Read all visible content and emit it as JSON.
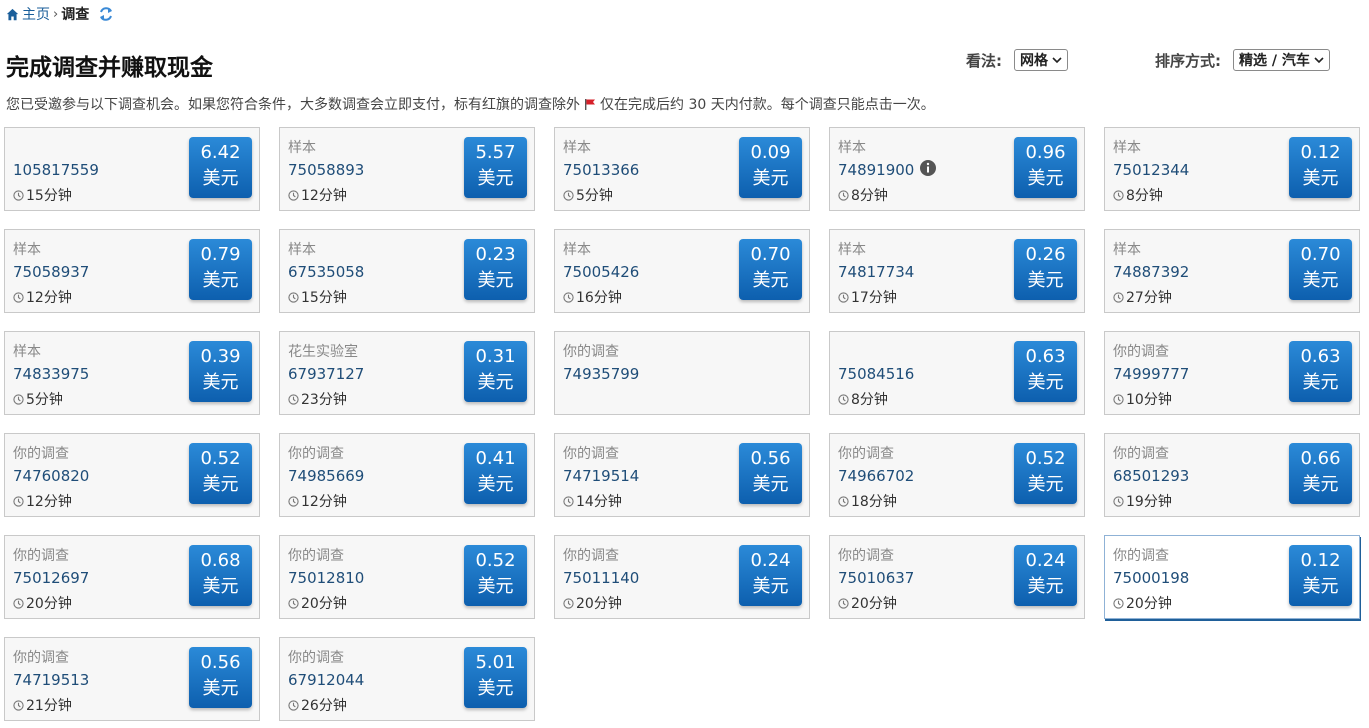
{
  "breadcrumb": {
    "home": "主页",
    "current": "调查"
  },
  "page_title": "完成调查并赚取现金",
  "view": {
    "label": "看法:",
    "value": "网格"
  },
  "sort": {
    "label": "排序方式:",
    "value": "精选 / 汽车"
  },
  "intro": {
    "before_flag": "您已受邀参与以下调查机会。如果您符合条件，大多数调查会立即支付，标有红旗的调查除外",
    "after_flag": "仅在完成后约 30 天内付款。每个调查只能点击一次。"
  },
  "surveys": [
    {
      "category": "",
      "id": "105817559",
      "duration": "15分钟",
      "price": "6.42 美元"
    },
    {
      "category": "样本",
      "id": "75058893",
      "duration": "12分钟",
      "price": "5.57 美元"
    },
    {
      "category": "样本",
      "id": "75013366",
      "duration": "5分钟",
      "price": "0.09 美元"
    },
    {
      "category": "样本",
      "id": "74891900",
      "duration": "8分钟",
      "price": "0.96 美元",
      "info": true
    },
    {
      "category": "样本",
      "id": "75012344",
      "duration": "8分钟",
      "price": "0.12 美元"
    },
    {
      "category": "样本",
      "id": "75058937",
      "duration": "12分钟",
      "price": "0.79 美元"
    },
    {
      "category": "样本",
      "id": "67535058",
      "duration": "15分钟",
      "price": "0.23 美元"
    },
    {
      "category": "样本",
      "id": "75005426",
      "duration": "16分钟",
      "price": "0.70 美元"
    },
    {
      "category": "样本",
      "id": "74817734",
      "duration": "17分钟",
      "price": "0.26 美元"
    },
    {
      "category": "样本",
      "id": "74887392",
      "duration": "27分钟",
      "price": "0.70 美元"
    },
    {
      "category": "样本",
      "id": "74833975",
      "duration": "5分钟",
      "price": "0.39 美元"
    },
    {
      "category": "花生实验室",
      "id": "67937127",
      "duration": "23分钟",
      "price": "0.31 美元"
    },
    {
      "category": "你的调查",
      "id": "74935799",
      "duration": "",
      "price": ""
    },
    {
      "category": "",
      "id": "75084516",
      "duration": "8分钟",
      "price": "0.63 美元"
    },
    {
      "category": "你的调查",
      "id": "74999777",
      "duration": "10分钟",
      "price": "0.63 美元"
    },
    {
      "category": "你的调查",
      "id": "74760820",
      "duration": "12分钟",
      "price": "0.52 美元"
    },
    {
      "category": "你的调查",
      "id": "74985669",
      "duration": "12分钟",
      "price": "0.41 美元"
    },
    {
      "category": "你的调查",
      "id": "74719514",
      "duration": "14分钟",
      "price": "0.56 美元"
    },
    {
      "category": "你的调查",
      "id": "74966702",
      "duration": "18分钟",
      "price": "0.52 美元"
    },
    {
      "category": "你的调查",
      "id": "68501293",
      "duration": "19分钟",
      "price": "0.66 美元"
    },
    {
      "category": "你的调查",
      "id": "75012697",
      "duration": "20分钟",
      "price": "0.68 美元"
    },
    {
      "category": "你的调查",
      "id": "75012810",
      "duration": "20分钟",
      "price": "0.52 美元"
    },
    {
      "category": "你的调查",
      "id": "75011140",
      "duration": "20分钟",
      "price": "0.24 美元"
    },
    {
      "category": "你的调查",
      "id": "75010637",
      "duration": "20分钟",
      "price": "0.24 美元"
    },
    {
      "category": "你的调查",
      "id": "75000198",
      "duration": "20分钟",
      "price": "0.12 美元",
      "selected": true
    },
    {
      "category": "你的调查",
      "id": "74719513",
      "duration": "21分钟",
      "price": "0.56 美元"
    },
    {
      "category": "你的调查",
      "id": "67912044",
      "duration": "26分钟",
      "price": "5.01 美元"
    }
  ],
  "colors": {
    "price_button": "#1a73c9",
    "link": "#1a5e9a",
    "flag": "#d6202a"
  },
  "icons": {
    "home": "home-icon",
    "refresh": "refresh-icon",
    "clock": "clock-icon",
    "info": "info-icon",
    "flag": "red-flag-icon",
    "chevron": "chevron-down-icon"
  }
}
